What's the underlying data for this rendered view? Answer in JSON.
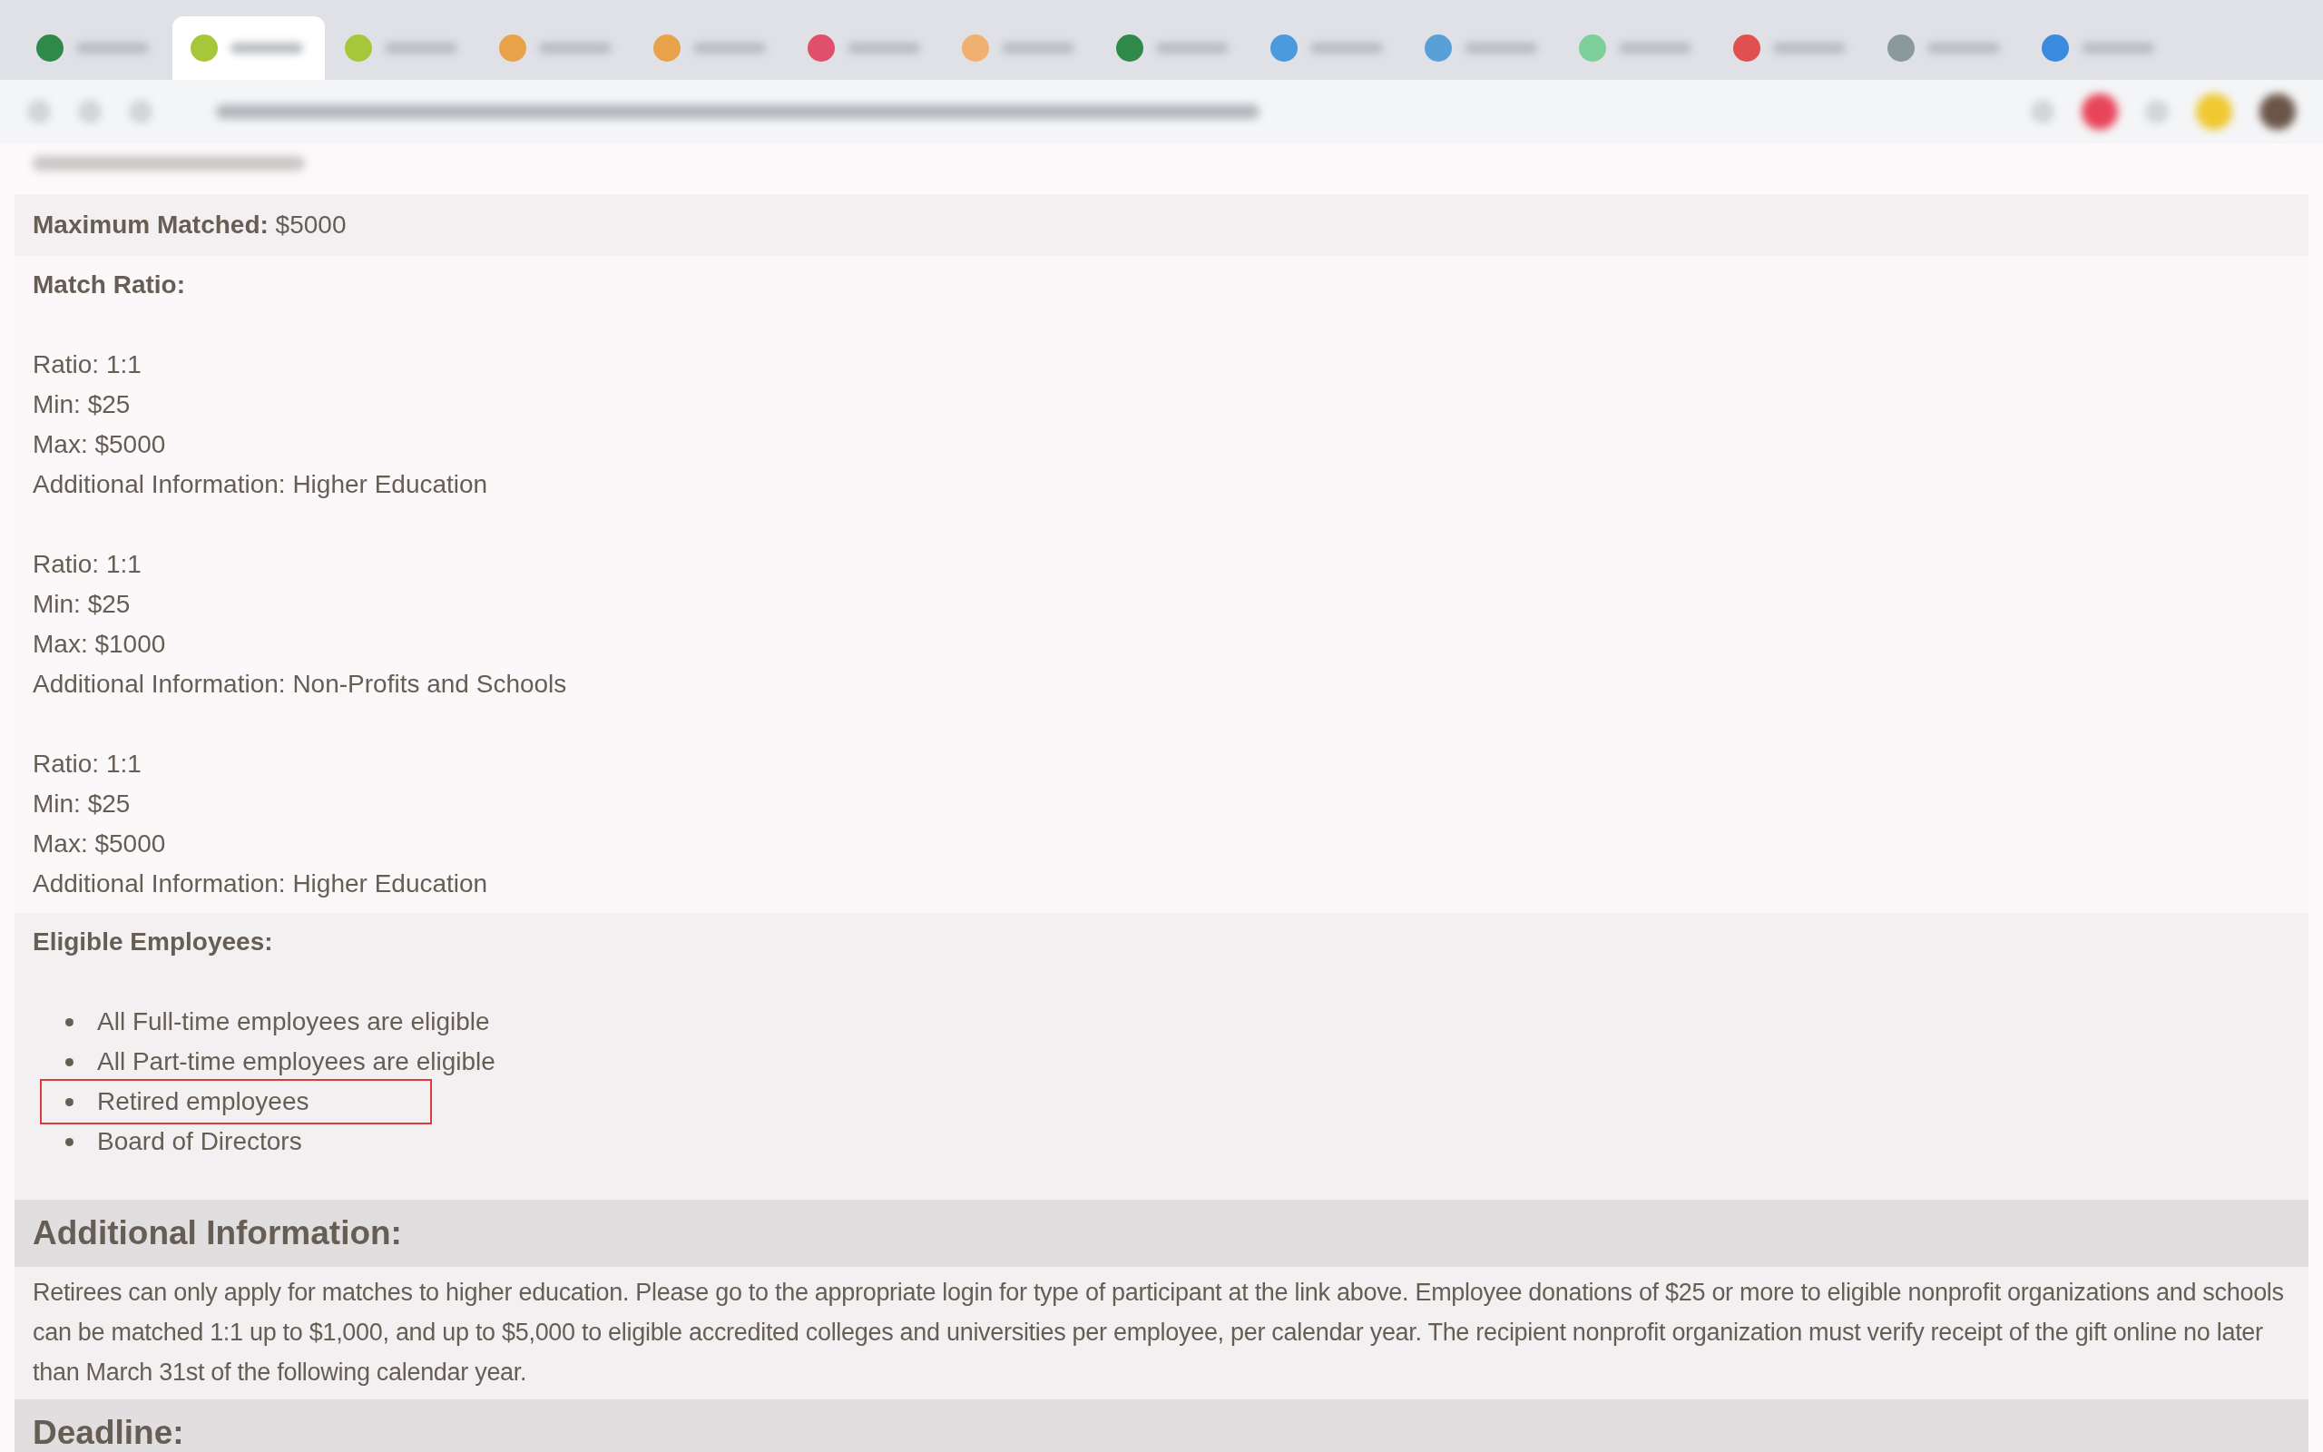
{
  "browser": {
    "tabs": [
      {
        "selected": false,
        "color": "#2f8a4a"
      },
      {
        "selected": true,
        "color": "#a7c73a"
      },
      {
        "selected": false,
        "color": "#a7c73a"
      },
      {
        "selected": false,
        "color": "#e8a24a"
      },
      {
        "selected": false,
        "color": "#e8a24a"
      },
      {
        "selected": false,
        "color": "#e0506a"
      },
      {
        "selected": false,
        "color": "#f0b070"
      },
      {
        "selected": false,
        "color": "#2f8a4a"
      },
      {
        "selected": false,
        "color": "#4a9ae0"
      },
      {
        "selected": false,
        "color": "#5aa0d8"
      },
      {
        "selected": false,
        "color": "#7fcf9a"
      },
      {
        "selected": false,
        "color": "#e05050"
      },
      {
        "selected": false,
        "color": "#8a9a9a"
      },
      {
        "selected": false,
        "color": "#3a8ae0"
      }
    ]
  },
  "maximum_matched": {
    "label": "Maximum Matched:",
    "value": "$5000"
  },
  "match_ratio": {
    "title": "Match Ratio:",
    "groups": [
      {
        "lines": [
          "Ratio: 1:1",
          "Min: $25",
          "Max: $5000",
          "Additional Information: Higher Education"
        ]
      },
      {
        "lines": [
          "Ratio: 1:1",
          "Min: $25",
          "Max: $1000",
          "Additional Information: Non-Profits and Schools"
        ]
      },
      {
        "lines": [
          "Ratio: 1:1",
          "Min: $25",
          "Max: $5000",
          "Additional Information: Higher Education"
        ]
      }
    ]
  },
  "eligible_employees": {
    "title": "Eligible Employees:",
    "items": [
      {
        "text": "All Full-time employees are eligible",
        "highlighted": false
      },
      {
        "text": "All Part-time employees are eligible",
        "highlighted": false
      },
      {
        "text": "Retired employees",
        "highlighted": true
      },
      {
        "text": "Board of Directors",
        "highlighted": false
      }
    ]
  },
  "additional_information": {
    "heading": "Additional Information:",
    "body": "Retirees can only apply for matches to higher education. Please go to the appropriate login for type of participant at the link above. Employee donations of $25 or more to eligible nonprofit organizations and schools can be matched 1:1 up to $1,000, and up to $5,000 to eligible accredited colleges and universities per employee, per calendar year. The recipient nonprofit organization must verify receipt of the gift online no later than March 31st of the following calendar year."
  },
  "deadline": {
    "heading": "Deadline:"
  }
}
